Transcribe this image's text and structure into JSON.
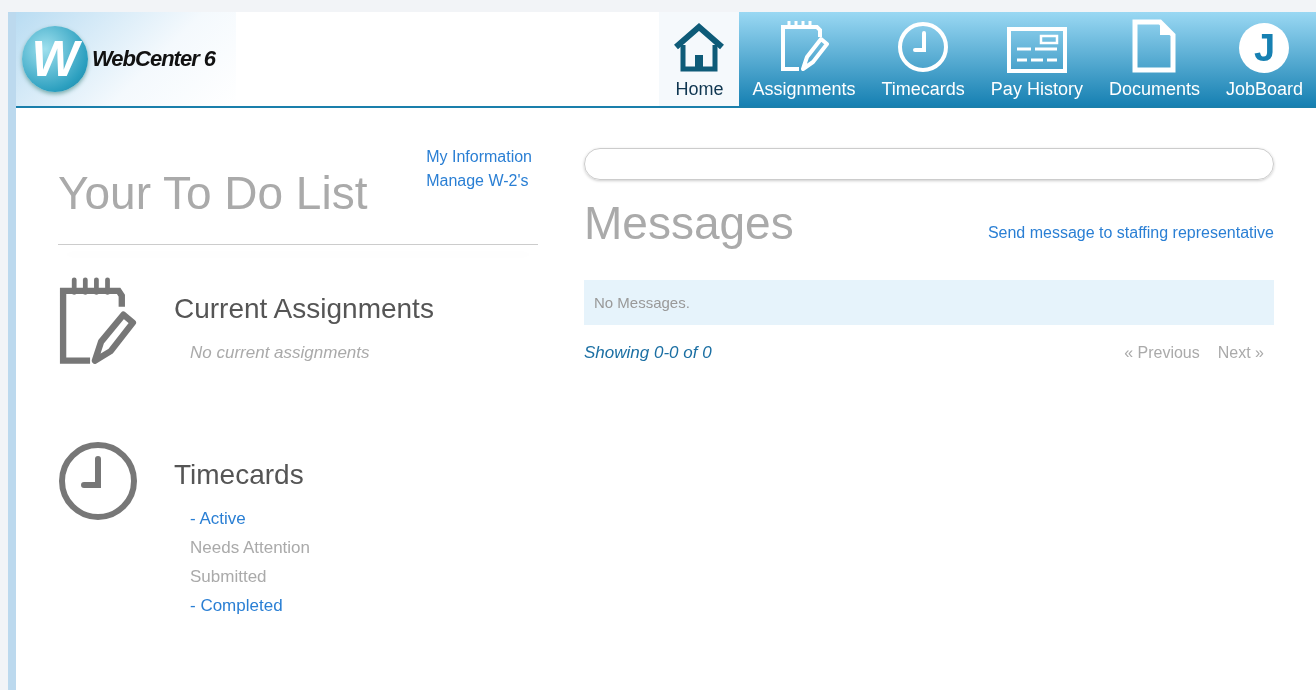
{
  "logo": {
    "letter": "W",
    "title": "WebCenter 6"
  },
  "nav": [
    {
      "label": "Home",
      "selected": true
    },
    {
      "label": "Assignments",
      "selected": false
    },
    {
      "label": "Timecards",
      "selected": false
    },
    {
      "label": "Pay History",
      "selected": false
    },
    {
      "label": "Documents",
      "selected": false
    },
    {
      "label": "JobBoard",
      "selected": false,
      "glyph": "J"
    }
  ],
  "todo": {
    "title": "Your To Do List",
    "links": [
      "My Information",
      "Manage W-2's"
    ],
    "assignments": {
      "heading": "Current Assignments",
      "empty": "No current assignments"
    },
    "timecards": {
      "heading": "Timecards",
      "items": [
        {
          "label": "- Active",
          "disabled": false
        },
        {
          "label": "Needs Attention",
          "disabled": true
        },
        {
          "label": "Submitted",
          "disabled": true
        },
        {
          "label": "- Completed",
          "disabled": false
        }
      ]
    }
  },
  "messages": {
    "title": "Messages",
    "send_link": "Send message to staffing representative",
    "empty": "No Messages.",
    "showing": "Showing 0-0 of 0",
    "pager": [
      {
        "label": "« Previous",
        "disabled": true
      },
      {
        "label": "Next »",
        "disabled": true
      }
    ]
  }
}
